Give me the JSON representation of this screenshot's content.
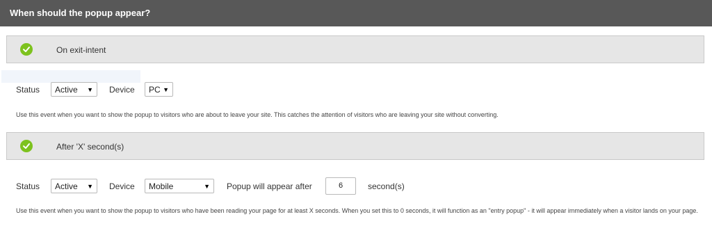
{
  "header": {
    "title": "When should the popup appear?"
  },
  "sections": [
    {
      "title": "On exit-intent",
      "status_label": "Status",
      "status_value": "Active",
      "device_label": "Device",
      "device_value": "PC",
      "description": "Use this event when you want to show the popup to visitors who are about to leave your site. This catches the attention of visitors who are leaving your site without converting."
    },
    {
      "title": "After 'X' second(s)",
      "status_label": "Status",
      "status_value": "Active",
      "device_label": "Device",
      "device_value": "Mobile",
      "delay_label": "Popup will appear after",
      "delay_value": "6",
      "delay_unit": "second(s)",
      "description": "Use this event when you want to show the popup to visitors who have been reading your page for at least X seconds. When you set this to 0 seconds, it will function as an \"entry popup\" - it will appear immediately when a visitor lands on your page."
    }
  ],
  "colors": {
    "header_bg": "#585858",
    "check_green": "#7dc21e",
    "section_bg": "#e6e6e6"
  },
  "icons": {
    "section_status": "check-circle-icon",
    "select": "caret-down-icon"
  }
}
